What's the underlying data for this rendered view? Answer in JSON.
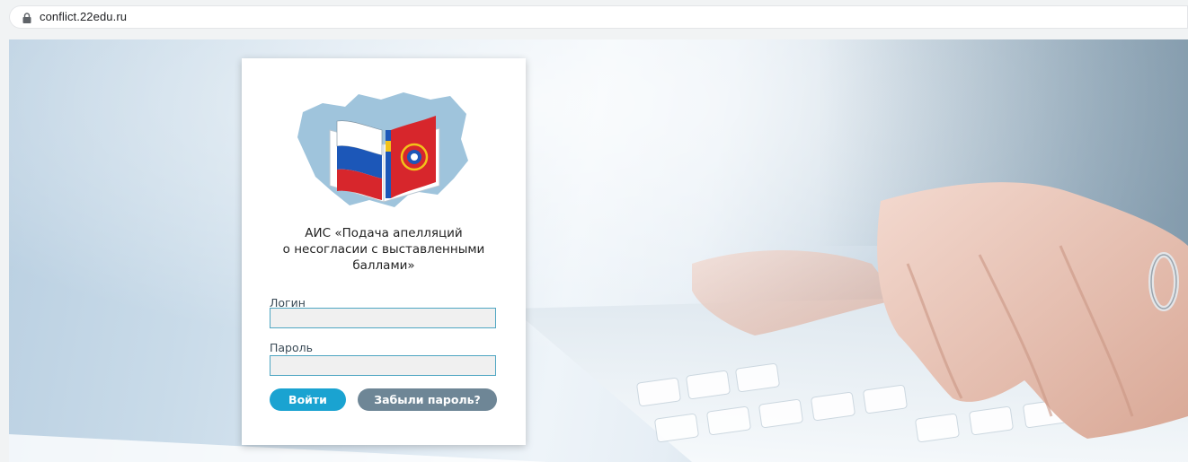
{
  "browser": {
    "url": "conflict.22edu.ru"
  },
  "login_card": {
    "title_lines": [
      "АИС «Подача апелляций",
      "о несогласии с выставленными",
      "баллами»"
    ],
    "login_label": "Логин",
    "login_value": "",
    "password_label": "Пароль",
    "password_value": "",
    "login_button": "Войти",
    "forgot_button": "Забыли пароль?"
  },
  "colors": {
    "primary_button": "#1aa3d1",
    "secondary_button": "#6e8696",
    "input_border": "#4fa6c2"
  }
}
